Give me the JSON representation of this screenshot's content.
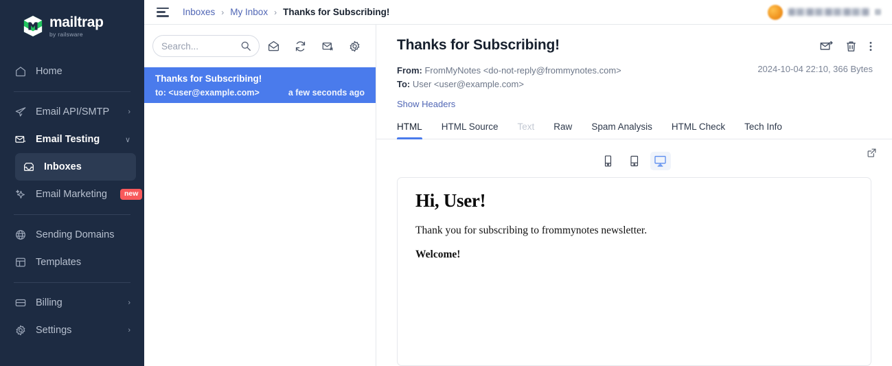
{
  "sidebar": {
    "logo": {
      "word": "mailtrap",
      "sub": "by railsware",
      "icon": "mailtrap-logo-icon"
    },
    "items": [
      {
        "label": "Home",
        "icon": "home-icon",
        "chevron": "",
        "badge": ""
      },
      {
        "label": "Email API/SMTP",
        "icon": "send-icon",
        "chevron": "›",
        "badge": ""
      },
      {
        "label": "Email Testing",
        "icon": "envelope-check-icon",
        "chevron": "∨",
        "badge": ""
      },
      {
        "label": "Inboxes",
        "icon": "inbox-icon",
        "chevron": "",
        "badge": ""
      },
      {
        "label": "Email Marketing",
        "icon": "sparkle-icon",
        "chevron": "",
        "badge": "new"
      },
      {
        "label": "Sending Domains",
        "icon": "globe-icon",
        "chevron": "",
        "badge": ""
      },
      {
        "label": "Templates",
        "icon": "template-icon",
        "chevron": "",
        "badge": ""
      },
      {
        "label": "Billing",
        "icon": "card-icon",
        "chevron": "›",
        "badge": ""
      },
      {
        "label": "Settings",
        "icon": "gear-icon",
        "chevron": "›",
        "badge": ""
      }
    ]
  },
  "topbar": {
    "menu_icon": "hamburger-icon",
    "breadcrumb": {
      "inboxes": "Inboxes",
      "sep1": "›",
      "my_inbox": "My Inbox",
      "sep2": "›",
      "current": "Thanks for Subscribing!"
    }
  },
  "list": {
    "search": {
      "value": "",
      "placeholder": "Search...",
      "icon": "search-icon"
    },
    "tools": [
      {
        "name": "mark-read-icon",
        "title": "Mark as read"
      },
      {
        "name": "refresh-icon",
        "title": "Refresh"
      },
      {
        "name": "delete-all-icon",
        "title": "Delete all"
      },
      {
        "name": "settings-icon",
        "title": "Settings"
      }
    ],
    "messages": [
      {
        "subject": "Thanks for Subscribing!",
        "to": "to: <user@example.com>",
        "time": "a few seconds ago"
      }
    ]
  },
  "detail": {
    "title": "Thanks for Subscribing!",
    "actions": [
      {
        "name": "forward-icon"
      },
      {
        "name": "trash-icon"
      },
      {
        "name": "more-vertical-icon"
      }
    ],
    "from_label": "From:",
    "from_value": "FromMyNotes <do-not-reply@frommynotes.com>",
    "to_label": "To:",
    "to_value": "User <user@example.com>",
    "meta_right": "2024-10-04 22:10, 366 Bytes",
    "show_headers": "Show Headers",
    "tabs": [
      {
        "label": "HTML",
        "state": "active"
      },
      {
        "label": "HTML Source",
        "state": "normal"
      },
      {
        "label": "Text",
        "state": "disabled"
      },
      {
        "label": "Raw",
        "state": "normal"
      },
      {
        "label": "Spam Analysis",
        "state": "normal"
      },
      {
        "label": "HTML Check",
        "state": "normal"
      },
      {
        "label": "Tech Info",
        "state": "normal"
      }
    ],
    "devices": [
      {
        "name": "mobile-preview-icon",
        "selected": false
      },
      {
        "name": "tablet-preview-icon",
        "selected": false
      },
      {
        "name": "desktop-preview-icon",
        "selected": true
      }
    ],
    "open_external_icon": "external-link-icon",
    "body": {
      "heading": "Hi, User!",
      "paragraph": "Thank you for subscribing to frommynotes newsletter.",
      "closing": "Welcome!"
    }
  },
  "colors": {
    "sidebar_bg": "#1d2b42",
    "accent_blue": "#4a7bec",
    "link_blue": "#5066b5",
    "badge_red": "#f8595b",
    "logo_green": "#22c55e"
  }
}
